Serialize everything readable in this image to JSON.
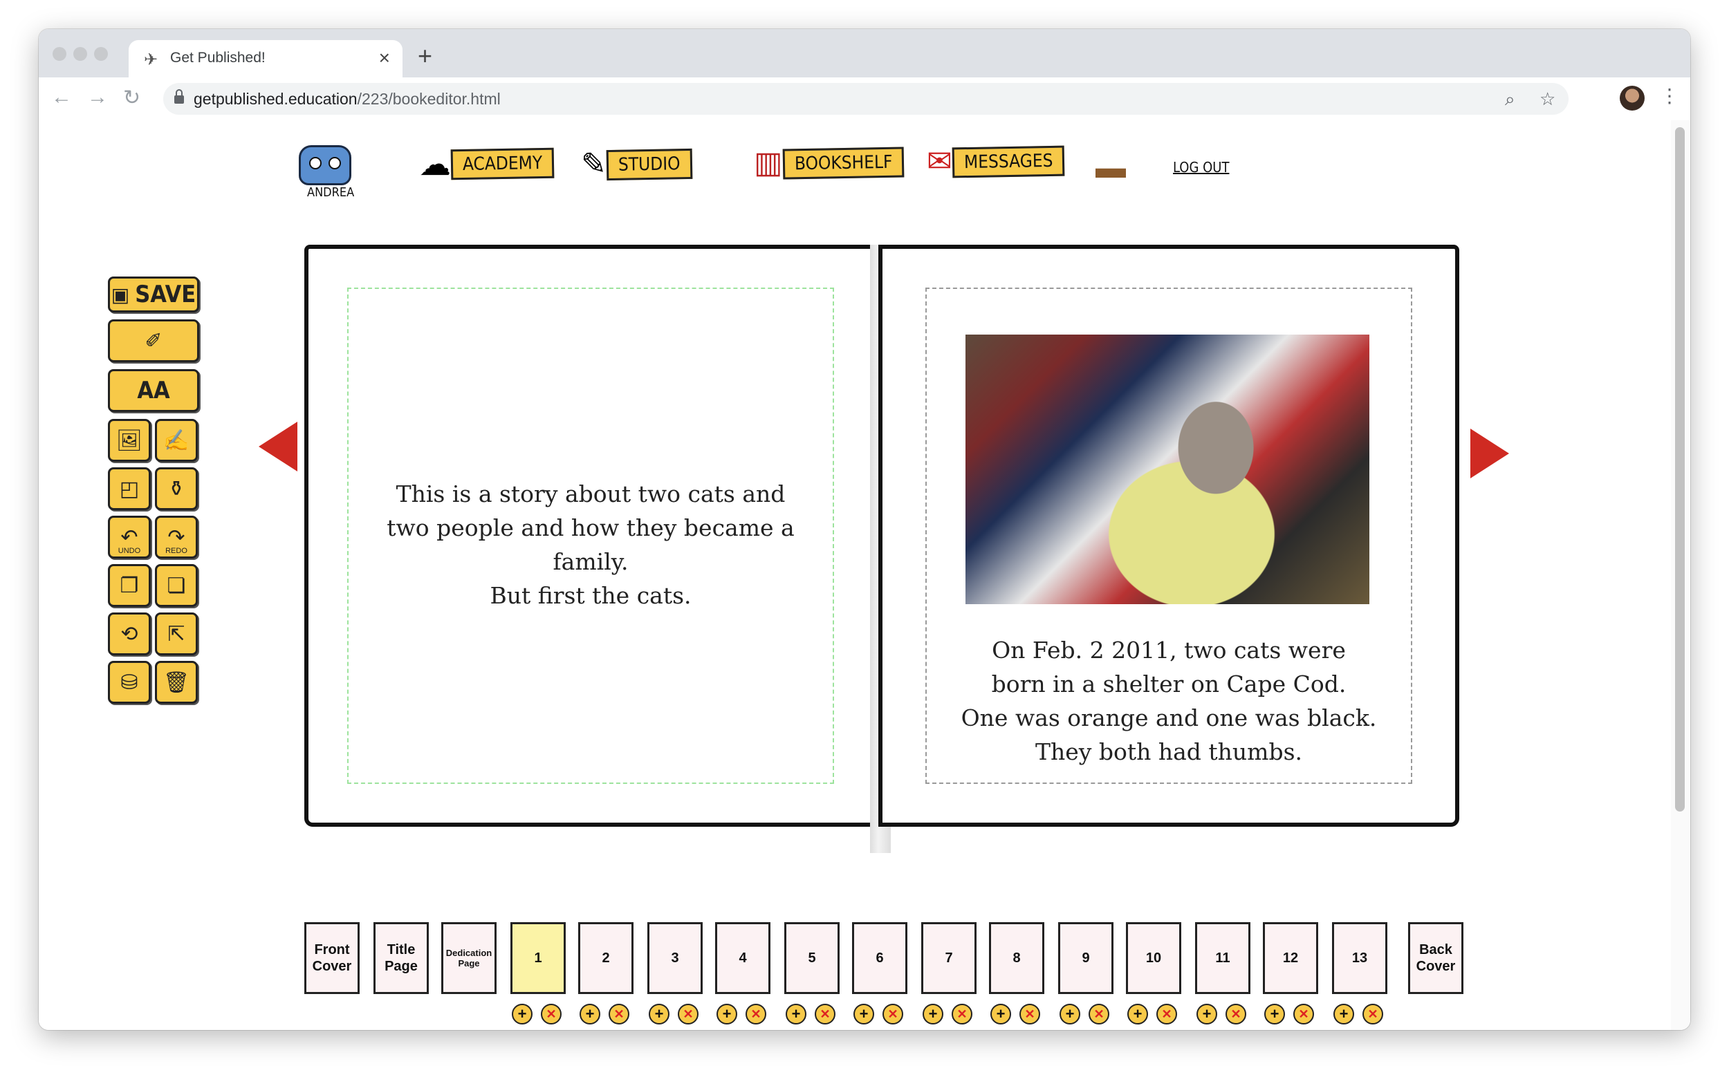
{
  "browser": {
    "tab_title": "Get Published!",
    "url_host": "getpublished.education",
    "url_path": "/223/bookeditor.html",
    "new_tab": "+",
    "close": "×"
  },
  "nav": {
    "user": "ANDREA",
    "academy": "ACADEMY",
    "studio": "STUDIO",
    "bookshelf": "BOOKSHELF",
    "messages": "MESSAGES",
    "logout": "LOG OUT"
  },
  "toolbar": {
    "save": "SAVE",
    "text_size": "AA",
    "undo": "UNDO",
    "redo": "REDO"
  },
  "book": {
    "left_text": [
      "This is a story about two cats and",
      "two people and how they became a family.",
      "But first the cats."
    ],
    "right_text": [
      "On Feb. 2 2011, two cats were",
      "born in a shelter on Cape Cod.",
      "One was orange and one was black.",
      "They both had thumbs."
    ]
  },
  "pages": [
    {
      "label": "Front Cover"
    },
    {
      "label": "Title Page"
    },
    {
      "label": "Dedication Page"
    },
    {
      "label": "1",
      "active": true
    },
    {
      "label": "2"
    },
    {
      "label": "3"
    },
    {
      "label": "4"
    },
    {
      "label": "5"
    },
    {
      "label": "6"
    },
    {
      "label": "7"
    },
    {
      "label": "8"
    },
    {
      "label": "9"
    },
    {
      "label": "10"
    },
    {
      "label": "11"
    },
    {
      "label": "12"
    },
    {
      "label": "13"
    },
    {
      "label": "Back Cover"
    }
  ],
  "colors": {
    "accent": "#f7c948",
    "arrow": "#cf2a22"
  }
}
